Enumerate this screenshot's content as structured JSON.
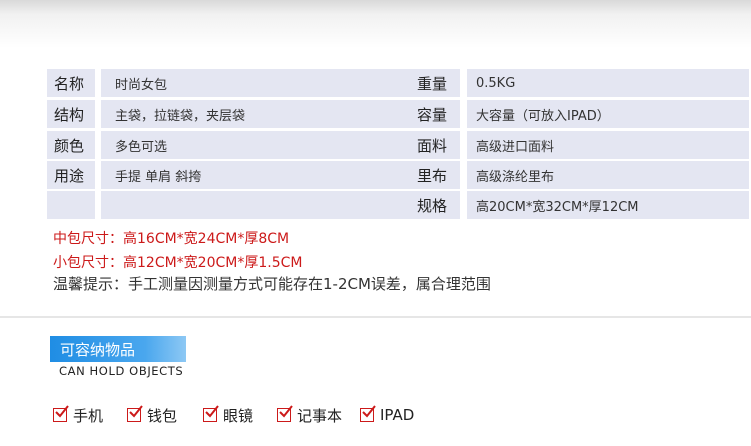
{
  "specs": {
    "left": [
      {
        "label": "名称",
        "value": "时尚女包"
      },
      {
        "label": "结构",
        "value": "主袋，拉链袋，夹层袋"
      },
      {
        "label": "颜色",
        "value": "多色可选"
      },
      {
        "label": "用途",
        "value": "手提 单肩 斜挎"
      },
      {
        "label": "",
        "value": ""
      }
    ],
    "right": [
      {
        "label": "重量",
        "value": "0.5KG"
      },
      {
        "label": "容量",
        "value": "大容量（可放入IPAD）"
      },
      {
        "label": "面料",
        "value": "高级进口面料"
      },
      {
        "label": "里布",
        "value": "高级涤纶里布"
      },
      {
        "label": "规格",
        "value": "高20CM*宽32CM*厚12CM"
      }
    ]
  },
  "notes": {
    "medium": "中包尺寸：高16CM*宽24CM*厚8CM",
    "small": "小包尺寸：高12CM*宽20CM*厚1.5CM",
    "tip": "温馨提示：手工测量因测量方式可能存在1-2CM误差，属合理范围"
  },
  "section": {
    "title": "可容纳物品",
    "subtitle": "CAN HOLD OBJECTS",
    "items": [
      "手机",
      "钱包",
      "眼镜",
      "记事本",
      "IPAD"
    ]
  },
  "colors": {
    "cell_bg": "#e4e6f2",
    "accent_red": "#cc1a1a",
    "section_blue": "#1f8de4"
  }
}
